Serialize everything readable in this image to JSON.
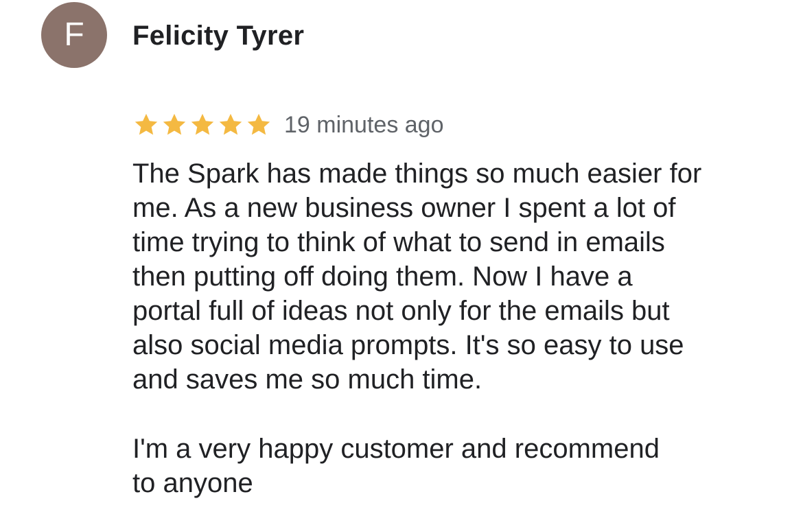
{
  "reviewer": {
    "initial": "F",
    "name": "Felicity Tyrer",
    "avatar_color": "#8b736b"
  },
  "review": {
    "rating": 5,
    "max_rating": 5,
    "star_color": "#f4b942",
    "star_icon": "star-icon",
    "timestamp": "19 minutes ago",
    "body": "The Spark has made things so much easier for\nme. As a new business owner I spent a lot of\ntime trying to think of what to send in emails\nthen putting off doing them. Now I have a\nportal full of ideas not only for the emails but\nalso social media prompts. It's so easy to use\nand saves me so much time.",
    "closing": "I'm a very happy customer and recommend\nto anyone"
  }
}
